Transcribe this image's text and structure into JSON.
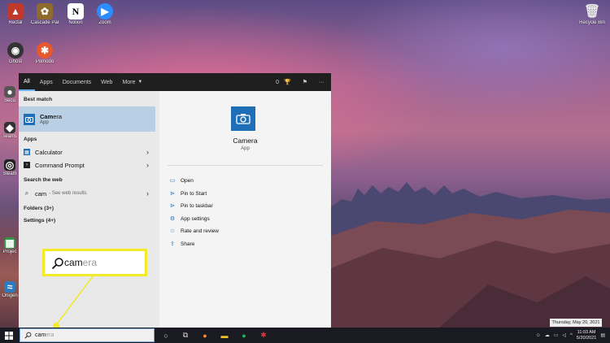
{
  "desktop": {
    "icons_left": [
      {
        "label": "Rectal",
        "icon": "app-icon-1",
        "color": "#c0392b"
      },
      {
        "label": "Cascade Pak",
        "icon": "app-icon-2",
        "color": "#8e6b2c"
      },
      {
        "label": "Notion",
        "icon": "notion-icon",
        "color": "#ffffff"
      },
      {
        "label": "Zoom",
        "icon": "zoom-icon",
        "color": "#2d8cff"
      },
      {
        "label": "Ghost",
        "icon": "alien-icon",
        "color": "#444444"
      },
      {
        "label": "Pomodo",
        "icon": "tomato-icon",
        "color": "#e8582f"
      }
    ],
    "recycle_bin_label": "Recycle Bin",
    "side_labels": [
      "Secu",
      "Teams",
      "Steam",
      "Projec",
      "Onigen"
    ]
  },
  "start_menu": {
    "tabs": [
      "All",
      "Apps",
      "Documents",
      "Web",
      "More"
    ],
    "active_tab": "All",
    "points": "0",
    "best_match_header": "Best match",
    "best_match": {
      "name_typed": "Cam",
      "name_rest": "era",
      "type": "App"
    },
    "apps_header": "Apps",
    "apps": [
      {
        "label": "Calculator",
        "icon": "calculator-icon"
      },
      {
        "label": "Command Prompt",
        "icon": "terminal-icon"
      }
    ],
    "web_header": "Search the web",
    "web_result": {
      "query": "cam",
      "sub": "- See web results"
    },
    "folders_label": "Folders (3+)",
    "settings_label": "Settings (4+)",
    "preview": {
      "name": "Camera",
      "type": "App",
      "actions": [
        "Open",
        "Pin to Start",
        "Pin to taskbar",
        "App settings",
        "Rate and review",
        "Share"
      ]
    }
  },
  "callout": {
    "typed": "cam",
    "suggestion": "era"
  },
  "taskbar": {
    "search_typed": "cam",
    "search_suggestion": "era",
    "time": "11:03 AM",
    "date": "5/20/2021",
    "date_tooltip": "Thursday, May 20, 2021"
  },
  "colors": {
    "accent": "#1e6fb8",
    "highlight": "#f3ea2a",
    "selection": "#b8cfe4"
  }
}
